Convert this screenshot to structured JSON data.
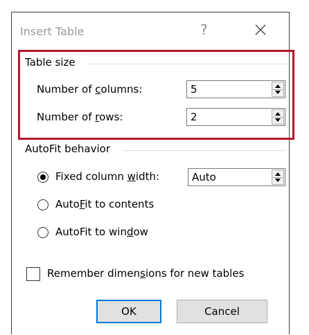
{
  "dialog": {
    "title": "Insert Table",
    "help_glyph": "?"
  },
  "table_size": {
    "heading": "Table size",
    "columns_label": {
      "pre": "Number of ",
      "accel": "c",
      "post": "olumns:"
    },
    "columns_value": "5",
    "rows_label": {
      "pre": "Number of ",
      "accel": "r",
      "post": "ows:"
    },
    "rows_value": "2"
  },
  "autofit": {
    "heading": "AutoFit behavior",
    "fixed": {
      "pre": "Fixed column ",
      "accel": "w",
      "post": "idth:",
      "checked": true
    },
    "fixed_value": "Auto",
    "contents": {
      "pre": "Auto",
      "accel": "F",
      "post": "it to contents",
      "checked": false
    },
    "window": {
      "pre": "AutoFit to win",
      "accel": "d",
      "post": "ow",
      "checked": false
    }
  },
  "remember": {
    "pre": "Remember dimen",
    "accel": "s",
    "post": "ions for new tables",
    "checked": false
  },
  "buttons": {
    "ok": "OK",
    "cancel": "Cancel"
  },
  "colors": {
    "highlight": "#b3162a",
    "default_button_border": "#0078d7"
  }
}
